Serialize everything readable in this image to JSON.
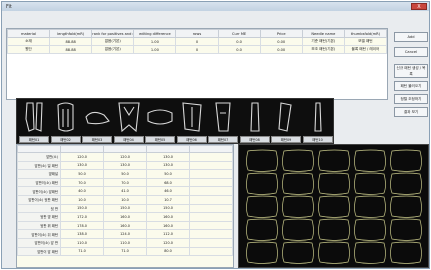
{
  "window": {
    "title": "Fit",
    "close_label": "X"
  },
  "top_table": {
    "headers": [
      "material",
      "lengthfold(mR)",
      "rank for positives and negatives (t)",
      "editing difference",
      "rows",
      "Curr ME",
      "Price",
      "Needle name",
      "thumbsfold(mR)"
    ],
    "rows": [
      [
        "소재",
        "88.88",
        "없음(기본)",
        "1.00",
        "0",
        "0.0",
        "0.00",
        "기준 패턴(기본)",
        "모델 패턴"
      ],
      [
        "원단",
        "88.88",
        "없음(기본)",
        "1.00",
        "0",
        "0.0",
        "0.00",
        "보조 패턴(기본)",
        "블록 패턴 / 레이어"
      ]
    ]
  },
  "side_buttons": [
    "Add",
    "Cancel",
    "신규 패턴 생성 / 목록",
    "패턴 불러오기",
    "정렬 조정하기",
    "결과 보기"
  ],
  "thumbnails": [
    "패턴01",
    "패턴02",
    "패턴03",
    "패턴04",
    "패턴05",
    "패턴06",
    "패턴07",
    "패턴08",
    "패턴09",
    "패턴10"
  ],
  "left_table": {
    "headers": [
      "",
      "",
      "",
      "",
      ""
    ],
    "rows": [
      [
        "앞판(소)",
        "120.0",
        "120.0",
        "130.0"
      ],
      [
        "앞판(소) 일 패턴",
        "130.0",
        "130.0",
        "130.0"
      ],
      [
        "옆패널",
        "50.0",
        "50.0",
        "50.0"
      ],
      [
        "앞판이(소) 패턴",
        "70.0",
        "70.0",
        "68.0"
      ],
      [
        "앞판이(소) 앞패턴",
        "40.0",
        "41.0",
        "46.0"
      ],
      [
        "앞판이(소) 뒷판 패턴",
        "10.0",
        "10.0",
        "10.7"
      ],
      [
        "뒷 판",
        "150.0",
        "150.0",
        "150.0"
      ],
      [
        "뒷판 옆 패턴",
        "172.0",
        "160.0",
        "160.0"
      ],
      [
        "뒷판 위 패턴",
        "178.0",
        "160.0",
        "160.0"
      ],
      [
        "앞판이(소) 뒤 패턴",
        "138.0",
        "124.0",
        "112.0"
      ],
      [
        "앞판이(소) 앞 판",
        "110.0",
        "110.0",
        "120.0"
      ],
      [
        "앞판이 앞 패턴",
        "71.0",
        "71.0",
        "80.0"
      ]
    ]
  },
  "canvas": {
    "pattern_color": "#c8c88a",
    "background": "#0b0b0b"
  }
}
